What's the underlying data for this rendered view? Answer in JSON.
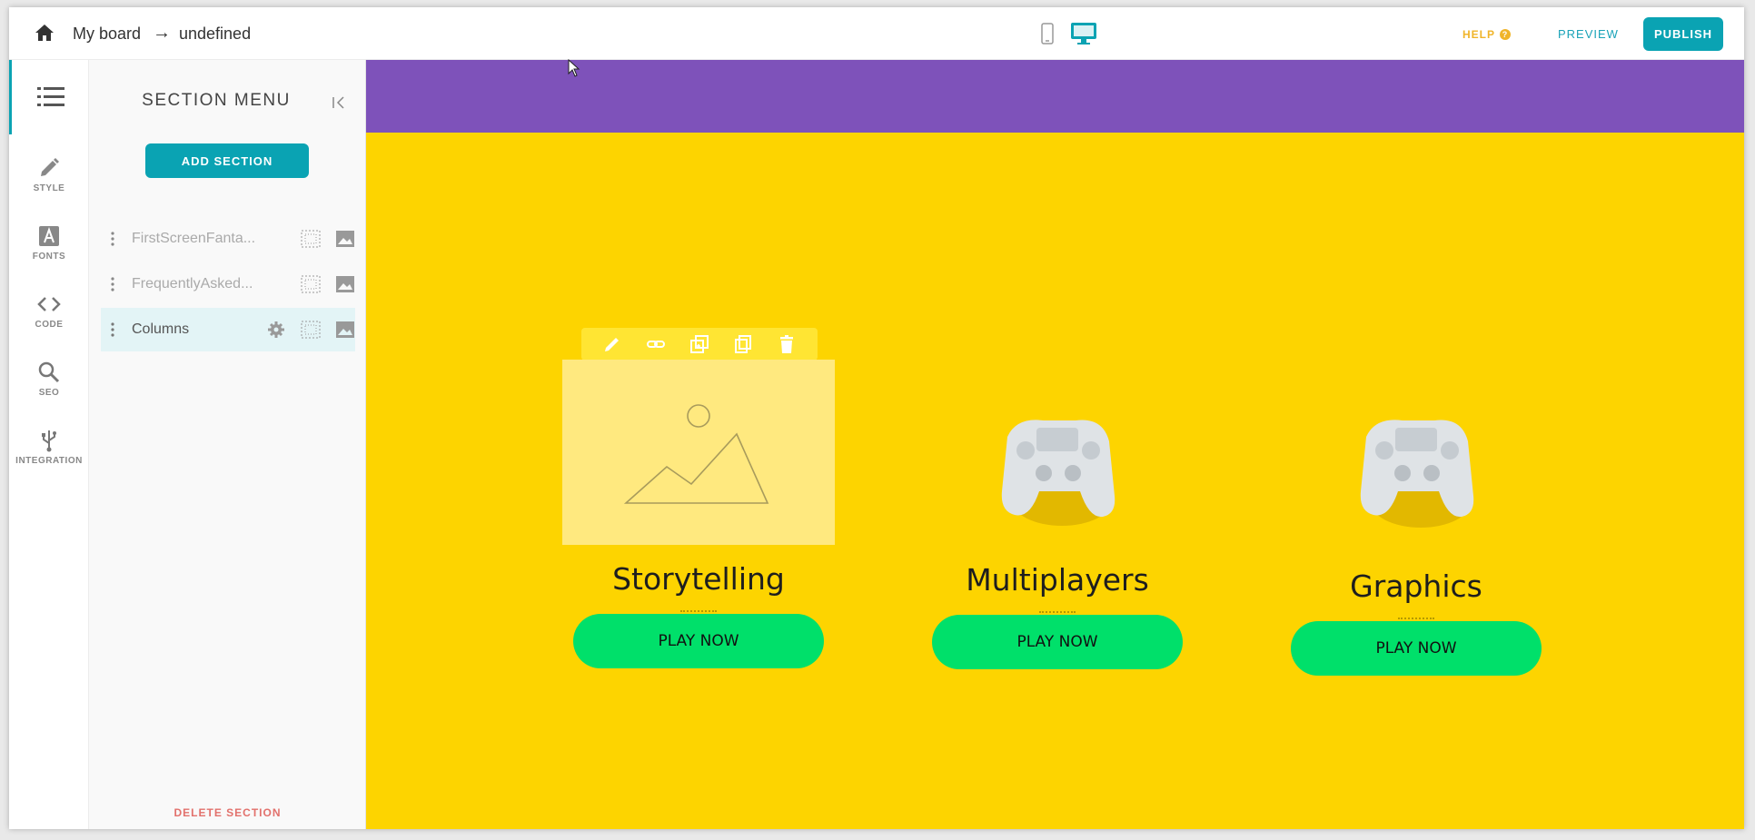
{
  "topbar": {
    "home_icon": "home-icon",
    "breadcrumb_board": "My board",
    "breadcrumb_arrow": "→",
    "breadcrumb_page": "undefined",
    "device_icons": [
      "mobile-icon",
      "desktop-icon"
    ],
    "help_label": "HELP",
    "help_badge": "?",
    "preview_label": "PREVIEW",
    "publish_label": "PUBLISH",
    "accent_color": "#0aa3b3"
  },
  "rail": {
    "items": [
      {
        "icon": "list-icon",
        "label": ""
      },
      {
        "icon": "pencil-icon",
        "label": "STYLE"
      },
      {
        "icon": "font-icon",
        "label": "FONTS"
      },
      {
        "icon": "code-icon",
        "label": "CODE"
      },
      {
        "icon": "search-icon",
        "label": "SEO"
      },
      {
        "icon": "usb-icon",
        "label": "INTEGRATION"
      }
    ]
  },
  "panel": {
    "title": "SECTION MENU",
    "add_section_label": "ADD SECTION",
    "sections": [
      {
        "name": "FirstScreenFanta...",
        "active": false
      },
      {
        "name": "FrequentlyAsked...",
        "active": false
      },
      {
        "name": "Columns",
        "active": true
      }
    ],
    "delete_section_label": "DELETE SECTION"
  },
  "canvas": {
    "band_color": "#7e52ba",
    "background_color": "#fdd400",
    "toolbar_icons": [
      "pencil-icon",
      "link-icon",
      "duplicate-icon",
      "copy-icon",
      "trash-icon"
    ],
    "columns": [
      {
        "title": "Storytelling",
        "button": "PLAY NOW",
        "image": "image-placeholder-icon"
      },
      {
        "title": "Multiplayers",
        "button": "PLAY NOW",
        "image": "gamepad-image"
      },
      {
        "title": "Graphics",
        "button": "PLAY NOW",
        "image": "gamepad-image"
      }
    ],
    "button_color": "#00e06a"
  }
}
